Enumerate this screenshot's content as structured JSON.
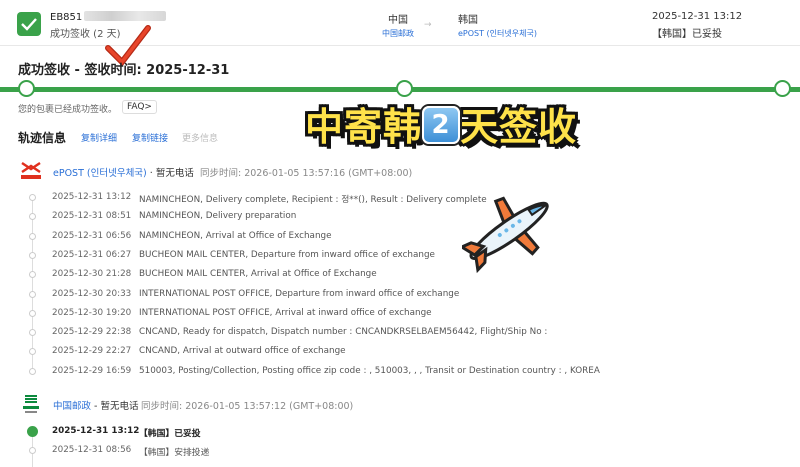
{
  "header": {
    "tracking_prefix": "EB851",
    "status_sub": "成功签收 (2 天)",
    "origin_country": "中国",
    "origin_post": "中国邮政",
    "dest_country": "韩国",
    "dest_post": "ePOST (인터넷우체국)",
    "last_time": "2025-12-31 13:12",
    "last_status": "【韩国】已妥投"
  },
  "delivery": {
    "title": "成功签收 - 签收时间: 2025-12-31",
    "desc": "您的包裹已经成功签收。",
    "faq": "FAQ>"
  },
  "overlay": {
    "part1": "中寄韩",
    "digit": "2",
    "part2": "天签收"
  },
  "tracking": {
    "title": "轨迹信息",
    "copy_detail": "复制详细",
    "copy_link": "复制链接",
    "more_info": "更多信息"
  },
  "carrier1": {
    "name": "ePOST (인터넷우체국)",
    "tel": " · 暂无电话",
    "sync": "同步时间: 2026-01-05 13:57:16 (GMT+08:00)",
    "events": [
      {
        "time": "2025-12-31 13:12",
        "text": "NAMINCHEON, Delivery complete, Recipient : 정**(), Result : Delivery complete"
      },
      {
        "time": "2025-12-31 08:51",
        "text": "NAMINCHEON, Delivery preparation"
      },
      {
        "time": "2025-12-31 06:56",
        "text": "NAMINCHEON, Arrival at Office of Exchange"
      },
      {
        "time": "2025-12-31 06:27",
        "text": "BUCHEON MAIL CENTER, Departure from inward office of exchange"
      },
      {
        "time": "2025-12-30 21:28",
        "text": "BUCHEON MAIL CENTER, Arrival at Office of Exchange"
      },
      {
        "time": "2025-12-30 20:33",
        "text": "INTERNATIONAL POST OFFICE, Departure from inward office of exchange"
      },
      {
        "time": "2025-12-30 19:20",
        "text": "INTERNATIONAL POST OFFICE, Arrival at inward office of exchange"
      },
      {
        "time": "2025-12-29 22:38",
        "text": "CNCAND, Ready for dispatch, Dispatch number : CNCANDKRSELBAEM56442, Flight/Ship No :"
      },
      {
        "time": "2025-12-29 22:27",
        "text": "CNCAND, Arrival at outward office of exchange"
      },
      {
        "time": "2025-12-29 16:59",
        "text": "510003, Posting/Collection, Posting office zip code : , 510003, , , Transit or Destination country : , KOREA"
      }
    ]
  },
  "carrier2": {
    "name": "中国邮政",
    "tel": " - 暂无电话",
    "sync": "同步时间: 2026-01-05 13:57:12 (GMT+08:00)",
    "events": [
      {
        "time": "2025-12-31 13:12",
        "text": "【韩国】已妥投"
      },
      {
        "time": "2025-12-31 08:56",
        "text": "【韩国】安排投递"
      }
    ]
  },
  "colors": {
    "accent": "#3aa24a",
    "link": "#2a6fd6",
    "overlay_text": "#ffe24a"
  }
}
